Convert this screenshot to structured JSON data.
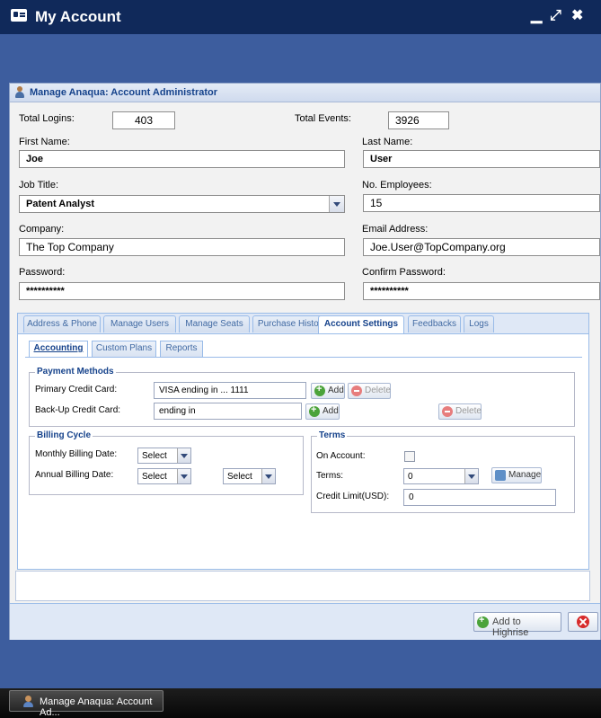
{
  "window": {
    "title": "My Account",
    "controls": {
      "minimize": "▁",
      "maximize": "⤢",
      "close": "✖"
    }
  },
  "panel": {
    "title": "Manage Anaqua: Account Administrator"
  },
  "form": {
    "total_logins_label": "Total Logins:",
    "total_logins_value": "403",
    "total_events_label": "Total Events:",
    "total_events_value": "3926",
    "first_name_label": "First Name:",
    "first_name_value": "Joe",
    "last_name_label": "Last Name:",
    "last_name_value": "User",
    "job_title_label": "Job Title:",
    "job_title_value": "Patent Analyst",
    "employees_label": "No. Employees:",
    "employees_value": "15",
    "company_label": "Company:",
    "company_value": "The Top Company",
    "email_label": "Email Address:",
    "email_value": "Joe.User@TopCompany.org",
    "password_label": "Password:",
    "password_value": "**********",
    "confirm_label": "Confirm Password:",
    "confirm_value": "**********"
  },
  "tabs": [
    {
      "label": "Address & Phone",
      "active": false
    },
    {
      "label": "Manage Users",
      "active": false
    },
    {
      "label": "Manage Seats",
      "active": false
    },
    {
      "label": "Purchase History",
      "active": false
    },
    {
      "label": "Account Settings",
      "active": true
    },
    {
      "label": "Feedbacks",
      "active": false
    },
    {
      "label": "Logs",
      "active": false
    }
  ],
  "subtabs": [
    {
      "label": "Accounting",
      "active": true
    },
    {
      "label": "Custom Plans",
      "active": false
    },
    {
      "label": "Reports",
      "active": false
    }
  ],
  "payment": {
    "legend": "Payment Methods",
    "primary_label": "Primary Credit Card:",
    "primary_value": "VISA ending in ... 1111",
    "backup_label": "Back-Up Credit Card:",
    "backup_value": "ending in",
    "add_label": "Add",
    "delete_label": "Delete"
  },
  "billing": {
    "legend": "Billing Cycle",
    "monthly_label": "Monthly Billing Date:",
    "annual_label": "Annual Billing Date:",
    "select_placeholder": "Select"
  },
  "terms": {
    "legend": "Terms",
    "on_account_label": "On Account:",
    "terms_label": "Terms:",
    "terms_value": "0",
    "manage_label": "Manage",
    "credit_limit_label": "Credit Limit(USD):",
    "credit_limit_value": "0"
  },
  "footer": {
    "add_highrise_label": "Add to Highrise"
  },
  "taskbar": {
    "item_label": "Manage Anaqua: Account Ad..."
  }
}
